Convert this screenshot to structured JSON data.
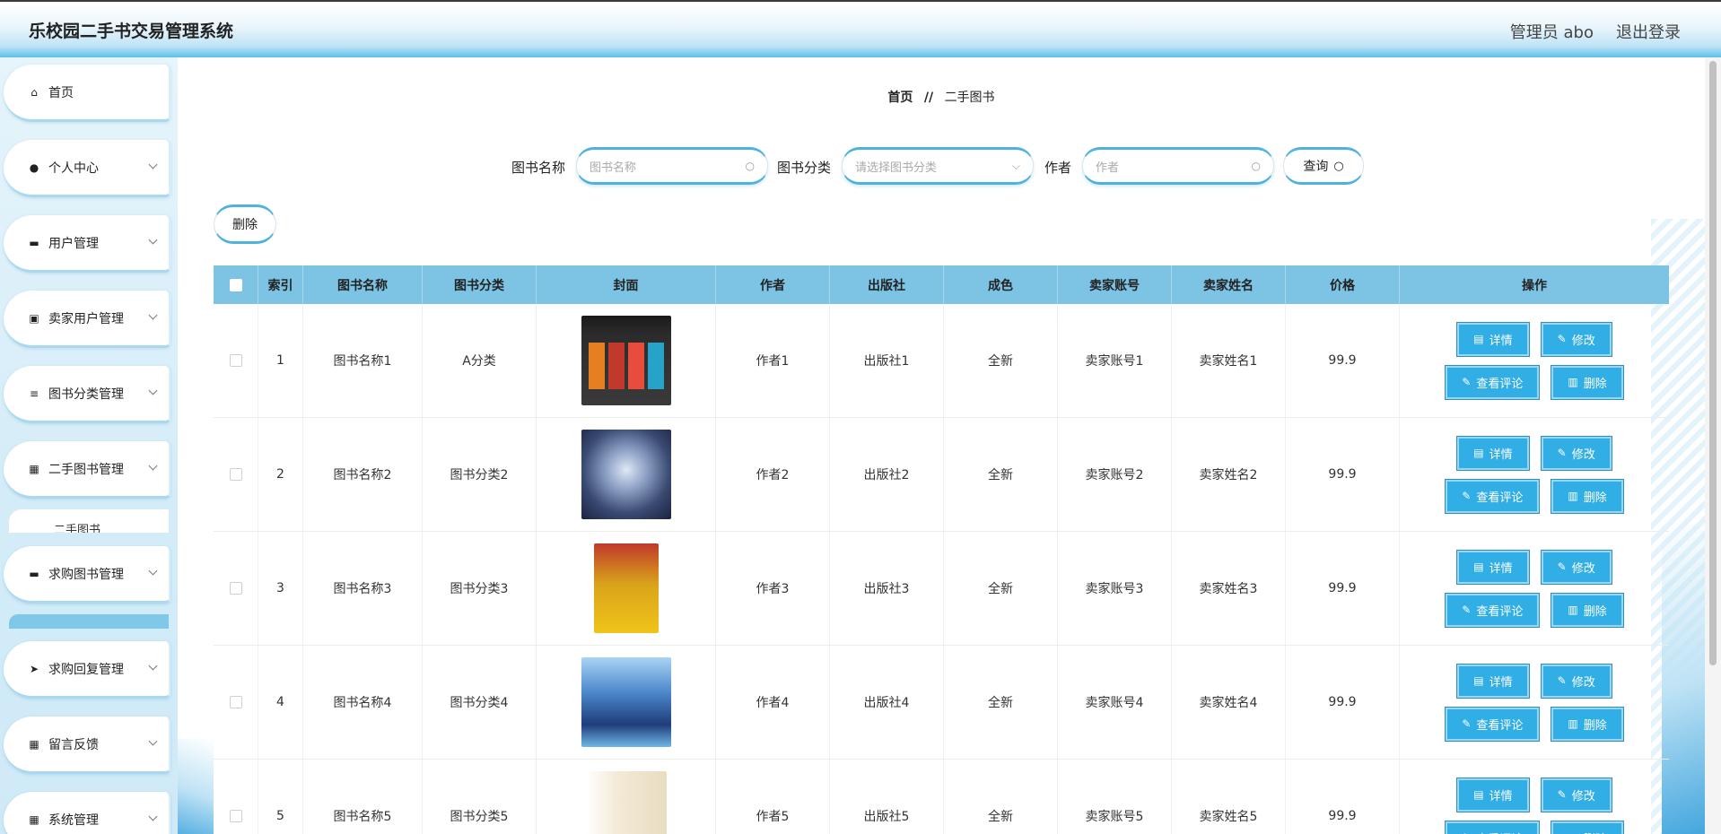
{
  "header": {
    "title": "乐校园二手书交易管理系统",
    "admin": "管理员 abo",
    "logout": "退出登录"
  },
  "sidebar": {
    "items": [
      {
        "label": "首页",
        "icon": "home-icon",
        "glyph": "⌂",
        "arrow": false
      },
      {
        "label": "个人中心",
        "icon": "user-icon",
        "glyph": "●",
        "arrow": true
      },
      {
        "label": "用户管理",
        "icon": "monitor-icon",
        "glyph": "▬",
        "arrow": true
      },
      {
        "label": "卖家用户管理",
        "icon": "chart-icon",
        "glyph": "▣",
        "arrow": true
      },
      {
        "label": "图书分类管理",
        "icon": "list-icon",
        "glyph": "≡",
        "arrow": true
      },
      {
        "label": "二手图书管理",
        "icon": "grid-icon",
        "glyph": "▦",
        "arrow": true
      },
      {
        "label": "求购图书管理",
        "icon": "message-icon",
        "glyph": "▬",
        "arrow": true
      },
      {
        "label": "求购回复管理",
        "icon": "send-icon",
        "glyph": "➤",
        "arrow": true
      },
      {
        "label": "留言反馈",
        "icon": "grid-icon",
        "glyph": "▦",
        "arrow": true
      },
      {
        "label": "系统管理",
        "icon": "grid-icon",
        "glyph": "▦",
        "arrow": true
      }
    ],
    "submenu_label": "二手图书"
  },
  "breadcrumb": {
    "home": "首页",
    "sep": "//",
    "current": "二手图书"
  },
  "search": {
    "name_label": "图书名称",
    "name_placeholder": "图书名称",
    "category_label": "图书分类",
    "category_placeholder": "请选择图书分类",
    "author_label": "作者",
    "author_placeholder": "作者",
    "query_label": "查询"
  },
  "toolbar": {
    "delete_label": "删除"
  },
  "table": {
    "columns": [
      "索引",
      "图书名称",
      "图书分类",
      "封面",
      "作者",
      "出版社",
      "成色",
      "卖家账号",
      "卖家姓名",
      "价格",
      "操作"
    ],
    "actions": {
      "detail": "详情",
      "edit": "修改",
      "comments": "查看评论",
      "delete": "删除"
    },
    "rows": [
      {
        "index": "1",
        "name": "图书名称1",
        "category": "A分类",
        "author": "作者1",
        "publisher": "出版社1",
        "condition": "全新",
        "seller_account": "卖家账号1",
        "seller_name": "卖家姓名1",
        "price": "99.9"
      },
      {
        "index": "2",
        "name": "图书名称2",
        "category": "图书分类2",
        "author": "作者2",
        "publisher": "出版社2",
        "condition": "全新",
        "seller_account": "卖家账号2",
        "seller_name": "卖家姓名2",
        "price": "99.9"
      },
      {
        "index": "3",
        "name": "图书名称3",
        "category": "图书分类3",
        "author": "作者3",
        "publisher": "出版社3",
        "condition": "全新",
        "seller_account": "卖家账号3",
        "seller_name": "卖家姓名3",
        "price": "99.9"
      },
      {
        "index": "4",
        "name": "图书名称4",
        "category": "图书分类4",
        "author": "作者4",
        "publisher": "出版社4",
        "condition": "全新",
        "seller_account": "卖家账号4",
        "seller_name": "卖家姓名4",
        "price": "99.9"
      },
      {
        "index": "5",
        "name": "图书名称5",
        "category": "图书分类5",
        "author": "作者5",
        "publisher": "出版社5",
        "condition": "全新",
        "seller_account": "卖家账号5",
        "seller_name": "卖家姓名5",
        "price": "99.9"
      }
    ]
  },
  "colors": {
    "accent": "#32aee6",
    "table_header": "#7cc3e4",
    "border_accent": "#4fb1dd"
  }
}
